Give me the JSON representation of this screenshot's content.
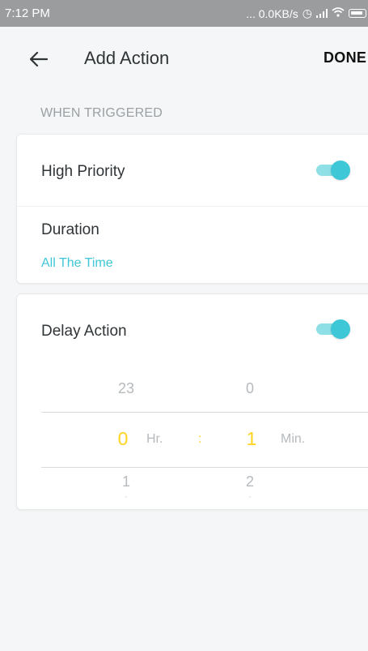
{
  "status_bar": {
    "time": "7:12 PM",
    "network": "... 0.0KB/s",
    "icons": [
      "alarm-icon",
      "signal-icon",
      "wifi-icon",
      "battery-icon"
    ]
  },
  "header": {
    "back_icon": "arrow-left-icon",
    "title": "Add Action",
    "done_label": "DONE"
  },
  "section": {
    "label": "WHEN TRIGGERED"
  },
  "priority_card": {
    "high_priority_label": "High Priority",
    "high_priority_on": true,
    "duration_label": "Duration",
    "duration_value": "All The Time"
  },
  "delay_card": {
    "delay_label": "Delay Action",
    "delay_on": true,
    "picker": {
      "hours_prev": "23",
      "hours_selected": "0",
      "hours_next": "1",
      "hours_unit": "Hr.",
      "separator": ":",
      "minutes_prev": "0",
      "minutes_selected": "1",
      "minutes_next": "2",
      "minutes_unit": "Min."
    }
  },
  "colors": {
    "accent": "#3ec7d6",
    "selected_value": "#ffd21f",
    "status_bar": "#9b9c9e"
  }
}
